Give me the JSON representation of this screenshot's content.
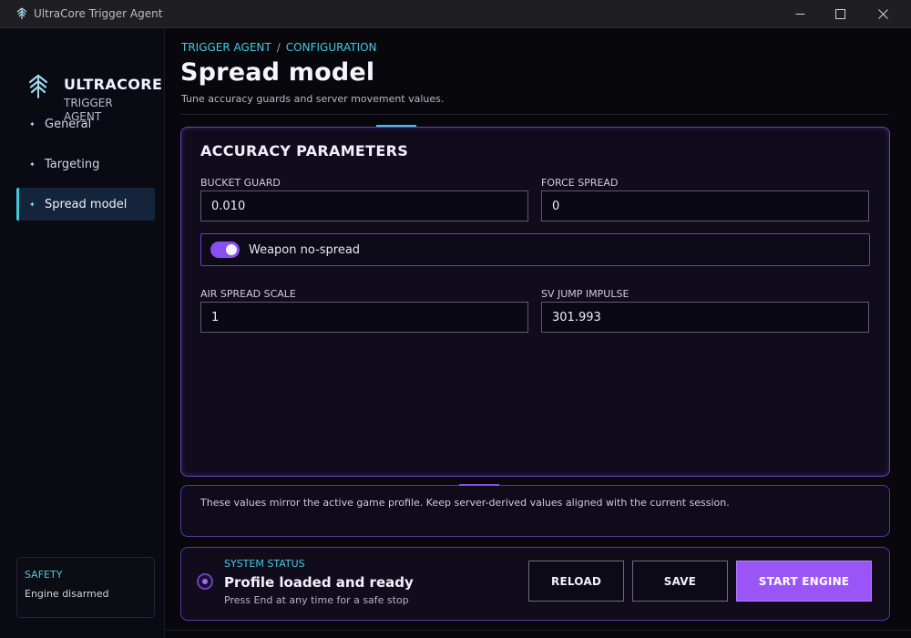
{
  "window": {
    "title": "UltraCore Trigger Agent"
  },
  "sidebar": {
    "brand": "ULTRACORE",
    "brand_sub": "TRIGGER AGENT",
    "items": [
      {
        "label": "General",
        "active": false
      },
      {
        "label": "Targeting",
        "active": false
      },
      {
        "label": "Spread model",
        "active": true
      }
    ],
    "safety": {
      "title": "SAFETY",
      "value": "Engine disarmed"
    }
  },
  "header": {
    "breadcrumb": [
      "TRIGGER AGENT",
      "CONFIGURATION"
    ],
    "breadcrumb_sep": "/",
    "title": "Spread model",
    "subtitle": "Tune accuracy guards and server movement values."
  },
  "accuracy": {
    "title": "ACCURACY PARAMETERS",
    "fields": {
      "bucket_guard": {
        "label": "BUCKET GUARD",
        "value": "0.010"
      },
      "force_spread": {
        "label": "FORCE SPREAD",
        "value": "0"
      },
      "air_spread_scale": {
        "label": "AIR SPREAD SCALE",
        "value": "1"
      },
      "sv_jump_impulse": {
        "label": "SV JUMP IMPULSE",
        "value": "301.993"
      }
    },
    "toggle": {
      "label": "Weapon no-spread",
      "checked": true
    }
  },
  "note": "These values mirror the active game profile. Keep server-derived values aligned with the current session.",
  "status": {
    "heading": "SYSTEM STATUS",
    "main": "Profile loaded and ready",
    "sub": "Press End at any time for a safe stop"
  },
  "actions": {
    "reload": "RELOAD",
    "save": "SAVE",
    "start": "START ENGINE"
  },
  "colors": {
    "accent_cyan": "#47c9e0",
    "accent_purple": "#9a55f7",
    "background": "#07070c"
  }
}
